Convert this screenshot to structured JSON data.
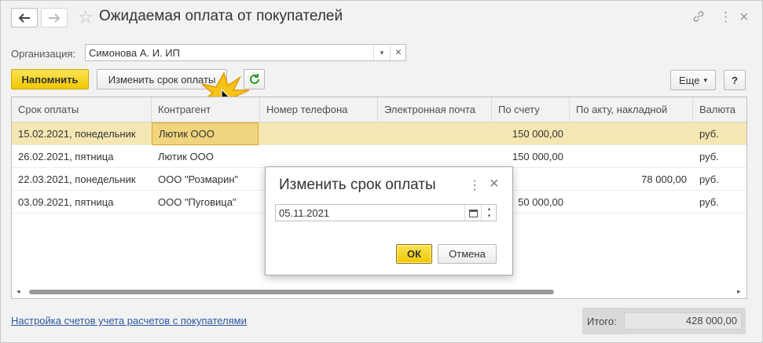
{
  "window": {
    "title": "Ожидаемая оплата от покупателей",
    "nav": {
      "back_icon": "arrow-left-icon",
      "forward_icon": "arrow-right-icon"
    },
    "header_icons": [
      "link-icon",
      "more-vert-icon",
      "close-icon"
    ]
  },
  "filter": {
    "org_label": "Организация:",
    "org_value": "Симонова А. И. ИП"
  },
  "toolbar": {
    "remind_label": "Напомнить",
    "change_due_label": "Изменить срок оплаты",
    "refresh_icon": "refresh-icon",
    "more_label": "Еще",
    "help_label": "?"
  },
  "table": {
    "columns": [
      "Срок оплаты",
      "Контрагент",
      "Номер телефона",
      "Электронная почта",
      "По счету",
      "По акту, накладной",
      "Валюта"
    ],
    "rows": [
      {
        "due": "15.02.2021, понедельник",
        "partner": "Лютик ООО",
        "phone": "",
        "email": "",
        "invoice": "150 000,00",
        "act": "",
        "currency": "руб."
      },
      {
        "due": "26.02.2021, пятница",
        "partner": "Лютик ООО",
        "phone": "",
        "email": "",
        "invoice": "150 000,00",
        "act": "",
        "currency": "руб."
      },
      {
        "due": "22.03.2021, понедельник",
        "partner": "ООО \"Розмарин\"",
        "phone": "",
        "email": "",
        "invoice": "",
        "act": "78 000,00",
        "currency": "руб."
      },
      {
        "due": "03.09.2021, пятница",
        "partner": "ООО \"Пуговица\"",
        "phone": "",
        "email": "",
        "invoice": "50 000,00",
        "act": "",
        "currency": "руб."
      }
    ]
  },
  "footer": {
    "settings_link": "Настройка счетов учета расчетов с покупателями",
    "total_label": "Итого:",
    "total_value": "428 000,00"
  },
  "dialog": {
    "title": "Изменить срок оплаты",
    "date_value": "05.11.2021",
    "ok_label": "ОК",
    "cancel_label": "Отмена"
  },
  "colors": {
    "accent_yellow": "#f0c800",
    "selection": "#f5e7b3",
    "link": "#2b58a0"
  }
}
